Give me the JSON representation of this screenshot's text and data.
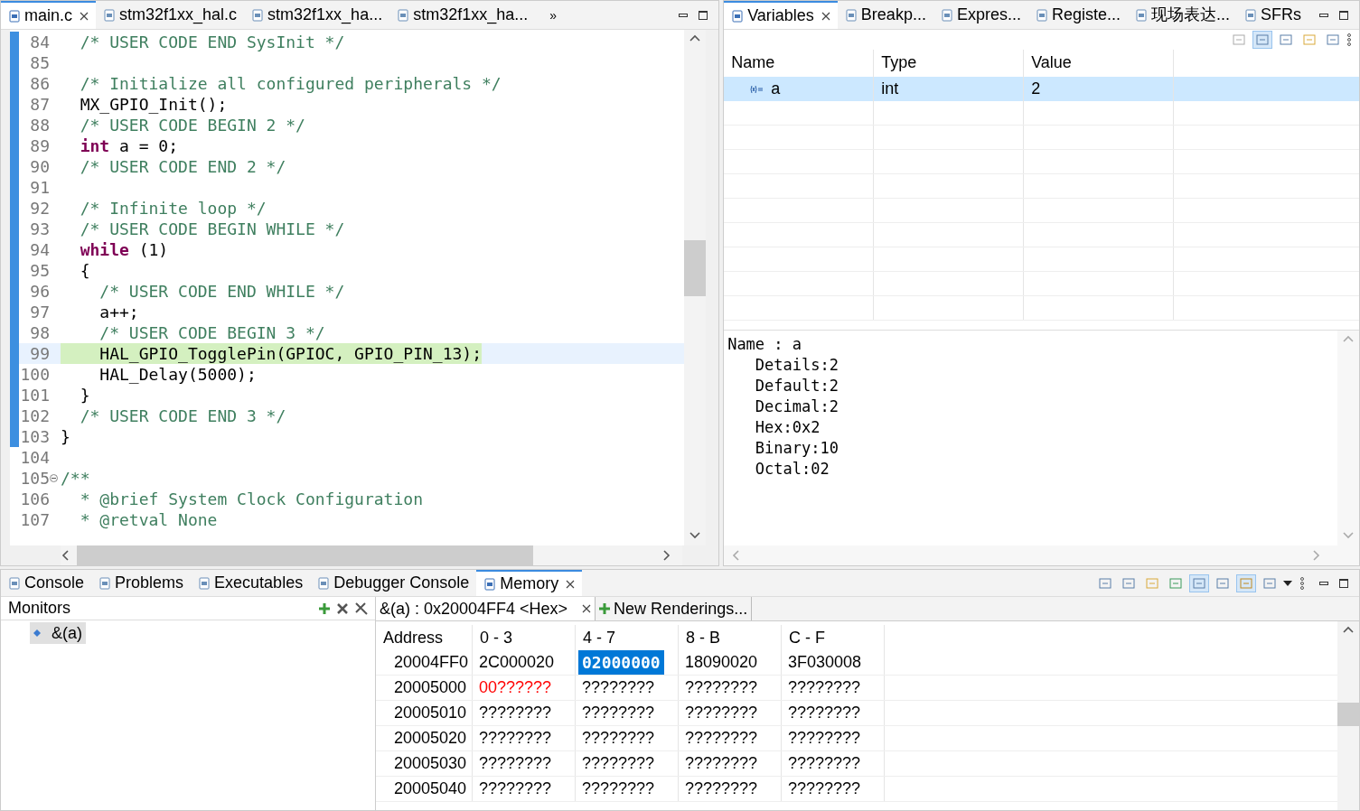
{
  "editor": {
    "tabs": [
      {
        "label": "main.c",
        "selected": true,
        "closable": true
      },
      {
        "label": "stm32f1xx_hal.c",
        "selected": false,
        "closable": false
      },
      {
        "label": "stm32f1xx_ha...",
        "selected": false,
        "closable": false
      },
      {
        "label": "stm32f1xx_ha...",
        "selected": false,
        "closable": false
      }
    ],
    "overflow": "»",
    "lines": [
      {
        "number": "84",
        "current": false,
        "segments": [
          {
            "text": "  /* USER CODE END SysInit */",
            "kind": "comment"
          }
        ]
      },
      {
        "number": "85",
        "current": false
      },
      {
        "number": "86",
        "current": false,
        "segments": [
          {
            "text": "  /* Initialize all configured peripherals */",
            "kind": "comment"
          }
        ]
      },
      {
        "number": "87",
        "current": false,
        "segments": [
          {
            "text": "  MX_GPIO_Init();",
            "kind": "plain"
          }
        ]
      },
      {
        "number": "88",
        "current": false,
        "segments": [
          {
            "text": "  /* USER CODE BEGIN 2 */",
            "kind": "comment"
          }
        ]
      },
      {
        "number": "89",
        "current": false,
        "segments": [
          {
            "text": "  int",
            "kind": "keyword"
          },
          {
            "text": " a = 0;",
            "kind": "plain"
          }
        ]
      },
      {
        "number": "90",
        "current": false,
        "segments": [
          {
            "text": "  /* USER CODE END 2 */",
            "kind": "comment"
          }
        ]
      },
      {
        "number": "91",
        "current": false
      },
      {
        "number": "92",
        "current": false,
        "segments": [
          {
            "text": "  /* Infinite loop */",
            "kind": "comment"
          }
        ]
      },
      {
        "number": "93",
        "current": false,
        "segments": [
          {
            "text": "  /* USER CODE BEGIN WHILE */",
            "kind": "comment"
          }
        ]
      },
      {
        "number": "94",
        "current": false,
        "segments": [
          {
            "text": "  while",
            "kind": "keyword"
          },
          {
            "text": " (1)",
            "kind": "plain"
          }
        ]
      },
      {
        "number": "95",
        "current": false,
        "segments": [
          {
            "text": "  {",
            "kind": "plain"
          }
        ]
      },
      {
        "number": "96",
        "current": false,
        "segments": [
          {
            "text": "    /* USER CODE END WHILE */",
            "kind": "comment"
          }
        ]
      },
      {
        "number": "97",
        "current": false,
        "segments": [
          {
            "text": "    a++;",
            "kind": "plain"
          }
        ]
      },
      {
        "number": "98",
        "current": false,
        "segments": [
          {
            "text": "    /* USER CODE BEGIN 3 */",
            "kind": "comment"
          }
        ]
      },
      {
        "number": "99",
        "current": true,
        "segments": [
          {
            "text": "    HAL_GPIO_TogglePin(GPIOC, GPIO_PIN_13);",
            "kind": "plain"
          }
        ]
      },
      {
        "number": "100",
        "current": false,
        "segments": [
          {
            "text": "    HAL_Delay(5000);",
            "kind": "plain"
          }
        ]
      },
      {
        "number": "101",
        "current": false,
        "segments": [
          {
            "text": "  }",
            "kind": "plain"
          }
        ]
      },
      {
        "number": "102",
        "current": false,
        "segments": [
          {
            "text": "  /* USER CODE END 3 */",
            "kind": "comment"
          }
        ]
      },
      {
        "number": "103",
        "current": false,
        "segments": [
          {
            "text": "}",
            "kind": "plain"
          }
        ]
      },
      {
        "number": "104",
        "current": false
      },
      {
        "number": "105",
        "current": false,
        "folded": true,
        "segments": [
          {
            "text": "/**",
            "kind": "comment"
          }
        ]
      },
      {
        "number": "106",
        "current": false,
        "segments": [
          {
            "text": "  * @brief System Clock Configuration",
            "kind": "comment"
          }
        ]
      },
      {
        "number": "107",
        "current": false,
        "segments": [
          {
            "text": "  * @retval None",
            "kind": "comment"
          }
        ]
      }
    ]
  },
  "debug_views": {
    "tabs": [
      {
        "label": "Variables",
        "selected": true,
        "closable": true
      },
      {
        "label": "Breakp...",
        "selected": false,
        "closable": false
      },
      {
        "label": "Expres...",
        "selected": false,
        "closable": false
      },
      {
        "label": "Registe...",
        "selected": false,
        "closable": false
      },
      {
        "label": "现场表达...",
        "selected": false,
        "closable": false
      },
      {
        "label": "SFRs",
        "selected": false,
        "closable": false
      }
    ],
    "columns": [
      "Name",
      "Type",
      "Value"
    ],
    "rows": [
      {
        "name": "a",
        "type": "int",
        "value": "2",
        "selected": true
      }
    ],
    "details": [
      "Name : a",
      "   Details:2",
      "   Default:2",
      "   Decimal:2",
      "   Hex:0x2",
      "   Binary:10",
      "   Octal:02"
    ]
  },
  "bottom": {
    "tabs": [
      {
        "label": "Console",
        "selected": false,
        "closable": false
      },
      {
        "label": "Problems",
        "selected": false,
        "closable": false
      },
      {
        "label": "Executables",
        "selected": false,
        "closable": false
      },
      {
        "label": "Debugger Console",
        "selected": false,
        "closable": false
      },
      {
        "label": "Memory",
        "selected": true,
        "closable": true
      }
    ],
    "monitors": {
      "title": "Monitors",
      "items": [
        {
          "label": "&(a)",
          "selected": true
        }
      ]
    },
    "renderings": [
      {
        "label": "&(a) : 0x20004FF4 <Hex>",
        "selected": true,
        "closable": true
      },
      {
        "label": "New Renderings...",
        "selected": false,
        "closable": false
      }
    ],
    "memory": {
      "columns": [
        "Address",
        "0 - 3",
        "4 - 7",
        "8 - B",
        "C - F"
      ],
      "rows": [
        {
          "cells": [
            {
              "text": "20004FF0",
              "selected": false,
              "changed": false
            },
            {
              "text": "2C000020",
              "selected": false,
              "changed": false
            },
            {
              "text": "02000000",
              "selected": true,
              "changed": false
            },
            {
              "text": "18090020",
              "selected": false,
              "changed": false
            },
            {
              "text": "3F030008",
              "selected": false,
              "changed": false
            }
          ]
        },
        {
          "cells": [
            {
              "text": "20005000",
              "selected": false,
              "changed": false
            },
            {
              "text": "00??????",
              "selected": false,
              "changed": true
            },
            {
              "text": "????????",
              "selected": false,
              "changed": false
            },
            {
              "text": "????????",
              "selected": false,
              "changed": false
            },
            {
              "text": "????????",
              "selected": false,
              "changed": false
            }
          ]
        },
        {
          "cells": [
            {
              "text": "20005010",
              "selected": false,
              "changed": false
            },
            {
              "text": "????????",
              "selected": false,
              "changed": false
            },
            {
              "text": "????????",
              "selected": false,
              "changed": false
            },
            {
              "text": "????????",
              "selected": false,
              "changed": false
            },
            {
              "text": "????????",
              "selected": false,
              "changed": false
            }
          ]
        },
        {
          "cells": [
            {
              "text": "20005020",
              "selected": false,
              "changed": false
            },
            {
              "text": "????????",
              "selected": false,
              "changed": false
            },
            {
              "text": "????????",
              "selected": false,
              "changed": false
            },
            {
              "text": "????????",
              "selected": false,
              "changed": false
            },
            {
              "text": "????????",
              "selected": false,
              "changed": false
            }
          ]
        },
        {
          "cells": [
            {
              "text": "20005030",
              "selected": false,
              "changed": false
            },
            {
              "text": "????????",
              "selected": false,
              "changed": false
            },
            {
              "text": "????????",
              "selected": false,
              "changed": false
            },
            {
              "text": "????????",
              "selected": false,
              "changed": false
            },
            {
              "text": "????????",
              "selected": false,
              "changed": false
            }
          ]
        },
        {
          "cells": [
            {
              "text": "20005040",
              "selected": false,
              "changed": false
            },
            {
              "text": "????????",
              "selected": false,
              "changed": false
            },
            {
              "text": "????????",
              "selected": false,
              "changed": false
            },
            {
              "text": "????????",
              "selected": false,
              "changed": false
            },
            {
              "text": "????????",
              "selected": false,
              "changed": false
            }
          ]
        }
      ]
    }
  }
}
